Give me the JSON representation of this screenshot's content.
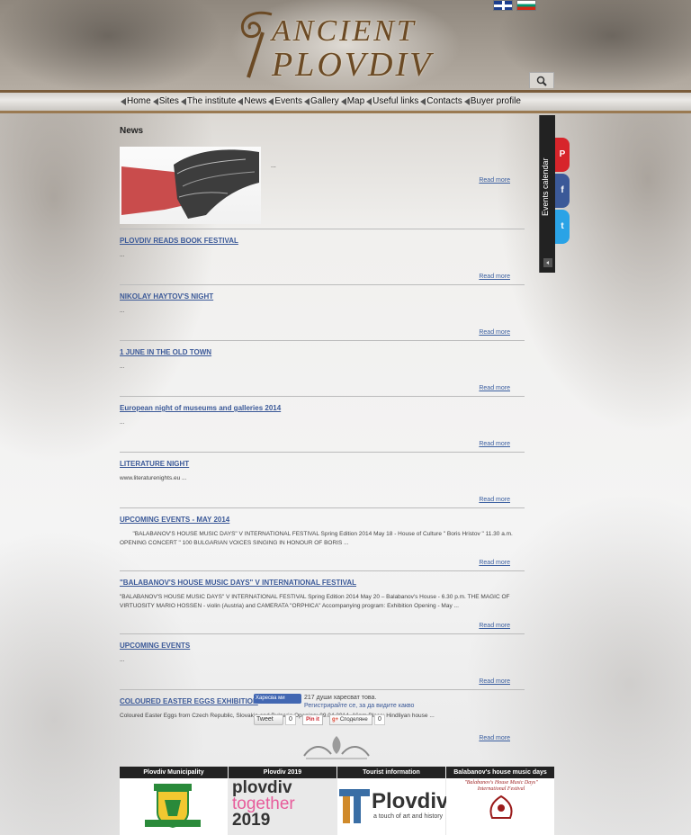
{
  "header": {
    "logo_line1": "ANCIENT",
    "logo_line2": "PLOVDIV",
    "flags": [
      "english-flag",
      "bulgarian-flag"
    ]
  },
  "nav": {
    "items": [
      "Home",
      "Sites",
      "The institute",
      "News",
      "Events",
      "Gallery",
      "Map",
      "Useful links",
      "Contacts",
      "Buyer profile"
    ]
  },
  "main": {
    "title": "News",
    "featured": {
      "text": "...",
      "read_more": "Read more"
    },
    "news": [
      {
        "title": "PLOVDIV READS BOOK FESTIVAL",
        "text": "...",
        "read_more": "Read more"
      },
      {
        "title": "NIKOLAY HAYTOV'S NIGHT",
        "text": "...",
        "read_more": "Read more"
      },
      {
        "title": "1 JUNE IN THE OLD TOWN",
        "text": "...",
        "read_more": "Read more"
      },
      {
        "title": "European night of museums and galleries 2014",
        "text": "...",
        "read_more": "Read more"
      },
      {
        "title": "LITERATURE NIGHT",
        "text": "www.literaturenights.eu ...",
        "read_more": "Read more"
      },
      {
        "title": "UPCOMING EVENTS - MAY 2014",
        "text": "        \"BALABANOV'S HOUSE MUSIC DAYS\" V INTERNATIONAL FESTIVAL Spring Edition 2014   May 18 - House of Culture \" Boris Hristov \" 11.30 a.m. OPENING CONCERT \" 100 BULGARIAN VOICES SINGING IN HONOUR OF BORIS ...",
        "read_more": "Read more"
      },
      {
        "title": "\"BALABANOV'S HOUSE MUSIC DAYS\" V INTERNATIONAL FESTIVAL",
        "text": "\"BALABANOV'S HOUSE MUSIC DAYS\" V INTERNATIONAL FESTIVAL Spring Edition 2014 May 20 – Balabanov's House - 6.30 p.m. THE MAGIC OF VIRTUOSITY MARIO HOSSEN - violin (Austria) and CAMERATA \"ORPHICA\" Accompanying program: Exhibition Opening - May ...",
        "read_more": "Read more"
      },
      {
        "title": "UPCOMING EVENTS",
        "text": "...",
        "read_more": "Read more"
      },
      {
        "title": "COLOURED EASTER EGGS EXHIBITION",
        "text": "Coloured Easter Eggs from Czech Republic, Slovakia and Bulgaria Opening: 09.04.2014. 16pm Place: Hindliyan house          ...",
        "read_more": "Read more"
      }
    ]
  },
  "sidebar": {
    "calendar_label": "Events calendar",
    "social": [
      "P",
      "f",
      "t"
    ]
  },
  "share": {
    "like_button": "Харесва ми",
    "like_count_text": "217 души харесват това.",
    "like_register": "Регистрирайте се, за да видите какво",
    "tweet_label": "Tweet",
    "tweet_count": "0",
    "pin_label": "Pin it",
    "gplus_label": "Споделяне",
    "gplus_count": "0"
  },
  "footer": {
    "columns": [
      {
        "heading": "Plovdiv Municipality"
      },
      {
        "heading": "Plovdiv 2019",
        "line1": "plovdiv",
        "line2": "together",
        "line3": "2019"
      },
      {
        "heading": "Tourist information",
        "brand": "Plovdiv",
        "tagline": "a touch of art and history"
      },
      {
        "heading": "Balabanov's house music days",
        "caption": "\"Balabanov's House Music Days\" International Festival"
      }
    ]
  }
}
